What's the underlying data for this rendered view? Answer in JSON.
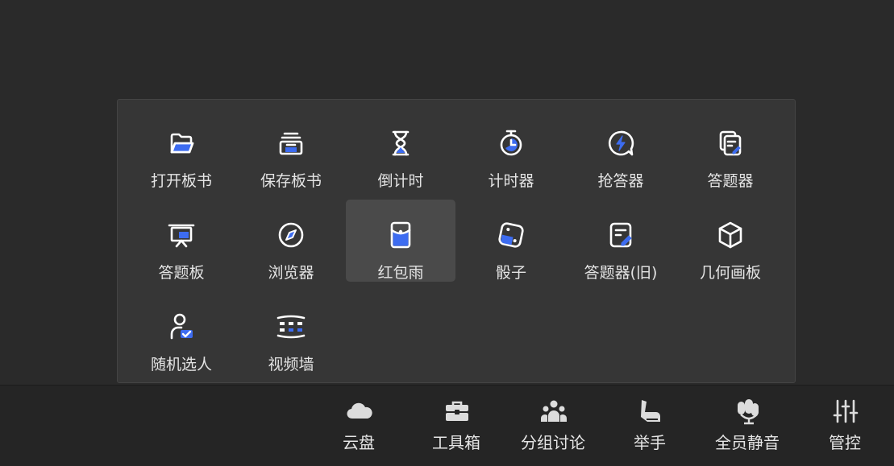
{
  "colors": {
    "accent": "#3d6cf0",
    "icon_white": "#ffffff",
    "toolbar_icon": "#dcdcdc"
  },
  "tools": [
    {
      "label": "打开板书",
      "icon": "folder-open-icon"
    },
    {
      "label": "保存板书",
      "icon": "archive-box-icon"
    },
    {
      "label": "倒计时",
      "icon": "hourglass-icon"
    },
    {
      "label": "计时器",
      "icon": "stopwatch-icon"
    },
    {
      "label": "抢答器",
      "icon": "buzzer-lightning-icon"
    },
    {
      "label": "答题器",
      "icon": "answer-sheets-icon"
    },
    {
      "label": "答题板",
      "icon": "presentation-board-icon"
    },
    {
      "label": "浏览器",
      "icon": "compass-icon"
    },
    {
      "label": "红包雨",
      "icon": "red-envelope-icon"
    },
    {
      "label": "骰子",
      "icon": "dice-icon"
    },
    {
      "label": "答题器(旧)",
      "icon": "answer-sheet-old-icon"
    },
    {
      "label": "几何画板",
      "icon": "cube-icon"
    },
    {
      "label": "随机选人",
      "icon": "random-person-icon"
    },
    {
      "label": "视频墙",
      "icon": "video-wall-icon"
    }
  ],
  "active_tool": "红包雨",
  "toolbar": {
    "items": [
      {
        "label": "云盘",
        "icon": "cloud-icon"
      },
      {
        "label": "工具箱",
        "icon": "toolbox-icon"
      },
      {
        "label": "分组讨论",
        "icon": "group-discussion-icon"
      },
      {
        "label": "举手",
        "icon": "raise-hand-icon"
      },
      {
        "label": "全员静音",
        "icon": "mute-all-icon"
      },
      {
        "label": "管控",
        "icon": "controls-sliders-icon"
      }
    ]
  }
}
